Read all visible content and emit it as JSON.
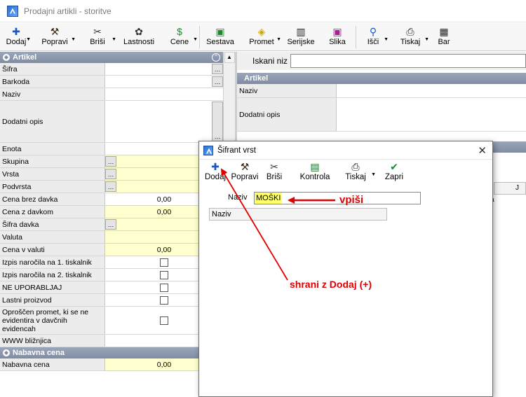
{
  "window": {
    "title": "Prodajni artikli - storitve"
  },
  "toolbar": [
    {
      "label": "Dodaj",
      "icon": "plus-icon",
      "dropdown": true
    },
    {
      "label": "Popravi",
      "icon": "hammer-icon",
      "dropdown": true
    },
    {
      "label": "Briši",
      "icon": "scissors-icon",
      "dropdown": true
    },
    {
      "label": "Lastnosti",
      "icon": "properties-icon",
      "dropdown": false
    },
    {
      "label": "Cene",
      "icon": "dollar-icon",
      "dropdown": true
    },
    {
      "label": "Sestava",
      "icon": "composition-icon",
      "dropdown": false
    },
    {
      "label": "Promet",
      "icon": "turnover-icon",
      "dropdown": true
    },
    {
      "label": "Serijske",
      "icon": "barcode-icon",
      "dropdown": false
    },
    {
      "label": "Slika",
      "icon": "picture-icon",
      "dropdown": false
    },
    {
      "label": "Išči",
      "icon": "search-icon",
      "dropdown": true
    },
    {
      "label": "Tiskaj",
      "icon": "printer-icon",
      "dropdown": true
    },
    {
      "label": "Bar",
      "icon": "barcode-print-icon",
      "dropdown": false
    }
  ],
  "artikel": {
    "header": "Artikel",
    "rows": [
      {
        "label": "Šifra",
        "value": "",
        "kind": "white",
        "ellipsis": "right"
      },
      {
        "label": "Barkoda",
        "value": "",
        "kind": "white",
        "ellipsis": "right"
      },
      {
        "label": "Naziv",
        "value": "",
        "kind": "white"
      },
      {
        "label": "Dodatni opis",
        "value": "",
        "kind": "white",
        "ellipsis": "right",
        "tall": true
      },
      {
        "label": "Enota",
        "value": "",
        "kind": "white"
      },
      {
        "label": "Skupina",
        "value": "",
        "kind": "yellow",
        "ellipsis": "left"
      },
      {
        "label": "Vrsta",
        "value": "",
        "kind": "yellow",
        "ellipsis": "left"
      },
      {
        "label": "Podvrsta",
        "value": "",
        "kind": "yellow",
        "ellipsis": "left"
      },
      {
        "label": "Cena brez davka",
        "value": "0,00",
        "kind": "white"
      },
      {
        "label": "Cena z davkom",
        "value": "0,00",
        "kind": "yellow"
      },
      {
        "label": "Šifra davka",
        "value": "",
        "kind": "yellow",
        "ellipsis": "left"
      },
      {
        "label": "Valuta",
        "value": "",
        "kind": "yellow"
      },
      {
        "label": "Cena v valuti",
        "value": "0,00",
        "kind": "yellow"
      },
      {
        "label": "Izpis naročila na 1. tiskalnik",
        "value": "",
        "kind": "checkbox"
      },
      {
        "label": "Izpis naročila na 2. tiskalnik",
        "value": "",
        "kind": "checkbox"
      },
      {
        "label": "NE UPORABLJAJ",
        "value": "",
        "kind": "checkbox"
      },
      {
        "label": "Lastni proizvod",
        "value": "",
        "kind": "checkbox"
      },
      {
        "label": "Oproščen promet, ki se ne evidentira v davčnih evidencah",
        "value": "",
        "kind": "checkbox",
        "tall": true
      },
      {
        "label": "WWW bližnjica",
        "value": "",
        "kind": "white"
      }
    ]
  },
  "nabavna": {
    "header": "Nabavna cena",
    "rows": [
      {
        "label": "Nabavna cena",
        "value": "0,00",
        "kind": "yellow"
      }
    ]
  },
  "right": {
    "search_label": "Iskani niz",
    "header": "Artikel",
    "rows": [
      {
        "label": "Naziv"
      },
      {
        "label": "Dodatni opis"
      }
    ],
    "tab_letter": "J",
    "partial_col": "ka\na"
  },
  "dialog": {
    "title": "Šifrant vrst",
    "close": "✕",
    "toolbar": [
      {
        "label": "Dodaj",
        "icon": "plus-icon"
      },
      {
        "label": "Popravi",
        "icon": "hammer-icon"
      },
      {
        "label": "Briši",
        "icon": "scissors-icon"
      },
      {
        "label": "Kontrola",
        "icon": "check-list-icon"
      },
      {
        "label": "Tiskaj",
        "icon": "printer-icon"
      },
      {
        "label": "Zapri",
        "icon": "checkmark-icon"
      }
    ],
    "search_label": "Naziv",
    "search_value": "MOŠKI",
    "column": "Naziv"
  },
  "annotations": {
    "vpisi": "vpiši",
    "shrani": "shrani z Dodaj  (+)",
    "color": "#e00000"
  }
}
